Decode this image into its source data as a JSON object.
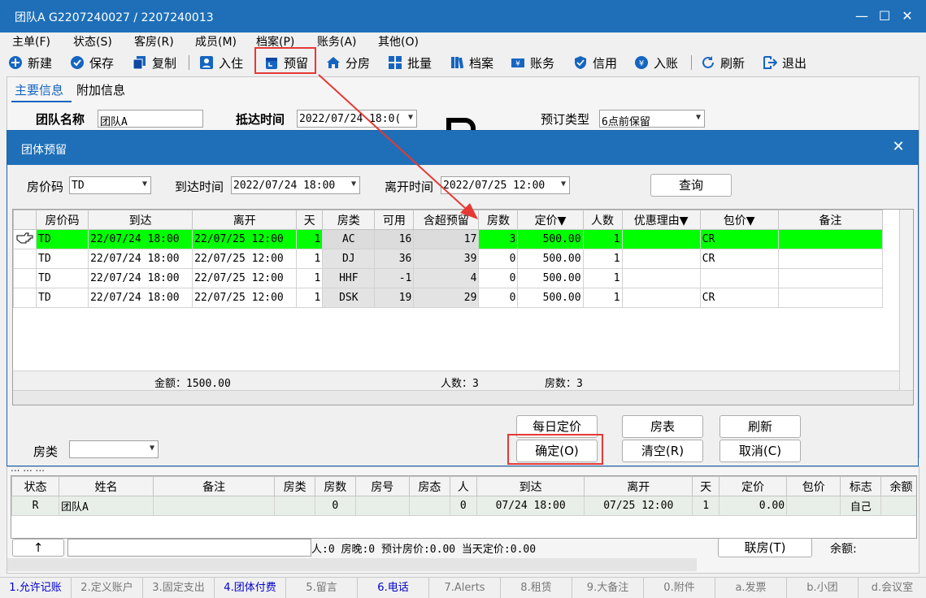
{
  "window": {
    "title": "团队A  G2207240027  /  2207240013",
    "min": "—",
    "max": "☐",
    "close": "✕"
  },
  "menu": [
    "主单(F)",
    "状态(S)",
    "客房(R)",
    "成员(M)",
    "档案(P)",
    "账务(A)",
    "其他(O)"
  ],
  "toolbar": [
    {
      "label": "新建",
      "icon": "plus-circle-icon"
    },
    {
      "label": "保存",
      "icon": "check-circle-icon"
    },
    {
      "label": "复制",
      "icon": "copy-icon"
    },
    {
      "label": "入住",
      "icon": "user-badge-icon"
    },
    {
      "label": "预留",
      "icon": "calendar-icon"
    },
    {
      "label": "分房",
      "icon": "home-icon"
    },
    {
      "label": "批量",
      "icon": "grid-icon"
    },
    {
      "label": "档案",
      "icon": "books-icon"
    },
    {
      "label": "账务",
      "icon": "money-icon"
    },
    {
      "label": "信用",
      "icon": "shield-icon"
    },
    {
      "label": "入账",
      "icon": "yen-circle-icon"
    },
    {
      "label": "刷新",
      "icon": "refresh-icon"
    },
    {
      "label": "退出",
      "icon": "exit-icon"
    }
  ],
  "main_tabs": [
    "主要信息",
    "附加信息"
  ],
  "group_form": {
    "name_label": "团队名称",
    "name_value": "团队A",
    "arrival_label": "抵达时间",
    "arrival_value": "2022/07/24 18:0(",
    "booking_type_label": "预订类型",
    "booking_type_value": "6点前保留"
  },
  "dialog": {
    "title": "团体预留",
    "close": "✕",
    "filters": {
      "rate_code_label": "房价码",
      "rate_code_value": "TD",
      "arrival_label": "到达时间",
      "arrival_value": "2022/07/24 18:00",
      "departure_label": "离开时间",
      "departure_value": "2022/07/25 12:00",
      "query_button": "查询"
    },
    "columns": [
      "房价码",
      "到达",
      "离开",
      "天",
      "房类",
      "可用",
      "含超预留",
      "房数",
      "定价▼",
      "人数",
      "优惠理由▼",
      "包价▼",
      "备注"
    ],
    "rows": [
      {
        "rate": "TD",
        "arrive": "22/07/24 18:00",
        "depart": "22/07/25 12:00",
        "days": "1",
        "room_type": "AC",
        "avail": "16",
        "incl_over": "17",
        "rooms": "3",
        "price": "500.00",
        "persons": "1",
        "reason": "",
        "package": "CR",
        "note": ""
      },
      {
        "rate": "TD",
        "arrive": "22/07/24 18:00",
        "depart": "22/07/25 12:00",
        "days": "1",
        "room_type": "DJ",
        "avail": "36",
        "incl_over": "39",
        "rooms": "0",
        "price": "500.00",
        "persons": "1",
        "reason": "",
        "package": "CR",
        "note": ""
      },
      {
        "rate": "TD",
        "arrive": "22/07/24 18:00",
        "depart": "22/07/25 12:00",
        "days": "1",
        "room_type": "HHF",
        "avail": "-1",
        "incl_over": "4",
        "rooms": "0",
        "price": "500.00",
        "persons": "1",
        "reason": "",
        "package": "",
        "note": ""
      },
      {
        "rate": "TD",
        "arrive": "22/07/24 18:00",
        "depart": "22/07/25 12:00",
        "days": "1",
        "room_type": "DSK",
        "avail": "19",
        "incl_over": "29",
        "rooms": "0",
        "price": "500.00",
        "persons": "1",
        "reason": "",
        "package": "CR",
        "note": ""
      }
    ],
    "summary": {
      "amount": "金额：1500.00",
      "persons": "人数：3",
      "rooms": "房数：3"
    },
    "room_type_label": "房类",
    "buttons": {
      "daily_price": "每日定价",
      "room_list": "房表",
      "refresh": "刷新",
      "ok": "确定(O)",
      "clear": "清空(R)",
      "cancel": "取消(C)"
    }
  },
  "lower": {
    "tab_fragment": "...  ...  ...",
    "columns": [
      "状态",
      "姓名",
      "备注",
      "房类",
      "房数",
      "房号",
      "房态",
      "人",
      "到达",
      "离开",
      "天",
      "定价",
      "包价",
      "标志",
      "余额"
    ],
    "row": {
      "status": "R",
      "name": "团队A",
      "note": "",
      "room_type": "",
      "rooms": "0",
      "room_no": "",
      "room_state": "",
      "persons": "0",
      "arrive": "07/24 18:00",
      "depart": "07/25 12:00",
      "days": "1",
      "price": "0.00",
      "package": "",
      "flag": "自己",
      "balance": ""
    },
    "up_button": "↑",
    "status_line": "人:0  房晚:0  预计房价:0.00  当天定价:0.00",
    "link_button": "联房(T)",
    "balance_label": "余额:"
  },
  "bottom_tabs": [
    {
      "label": "1.允许记账",
      "active": true
    },
    {
      "label": "2.定义账户",
      "active": false
    },
    {
      "label": "3.固定支出",
      "active": false
    },
    {
      "label": "4.团体付费",
      "active": true
    },
    {
      "label": "5.留言",
      "active": false
    },
    {
      "label": "6.电话",
      "active": true
    },
    {
      "label": "7.Alerts",
      "active": false
    },
    {
      "label": "8.租赁",
      "active": false
    },
    {
      "label": "9.大备注",
      "active": false
    },
    {
      "label": "0.附件",
      "active": false
    },
    {
      "label": "a.发票",
      "active": false
    },
    {
      "label": "b.小团",
      "active": false
    },
    {
      "label": "d.会议室",
      "active": false
    }
  ],
  "colors": {
    "title_bar": "#1e6fb8",
    "selected_row": "#00ff00",
    "highlight": "#e53935",
    "icon_blue": "#1565c0",
    "active_tab_text": "#0000cc"
  }
}
